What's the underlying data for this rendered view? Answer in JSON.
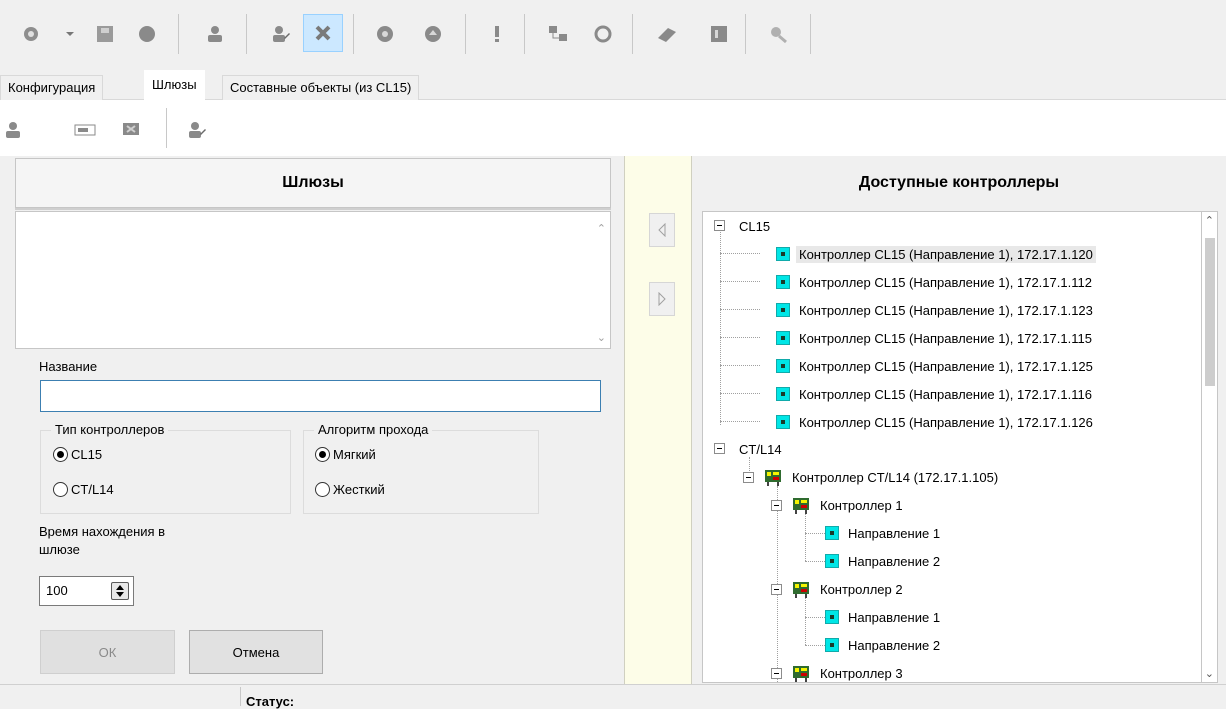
{
  "tabs": [
    {
      "label": "Конфигурация"
    },
    {
      "label": "Шлюзы"
    },
    {
      "label": "Составные объекты (из CL15)"
    }
  ],
  "left": {
    "header": "Шлюзы",
    "name_label": "Название",
    "name_value": "",
    "controller_type": {
      "title": "Тип контроллеров",
      "options": [
        "CL15",
        "CT/L14"
      ],
      "selected": "CL15"
    },
    "algorithm": {
      "title": "Алгоритм прохода",
      "options": [
        "Мягкий",
        "Жесткий"
      ],
      "selected": "Мягкий"
    },
    "time_label_line1": "Время нахождения в",
    "time_label_line2": "шлюзе",
    "time_value": "100",
    "ok_label": "ОК",
    "cancel_label": "Отмена"
  },
  "right": {
    "header": "Доступные контроллеры",
    "tree": {
      "cl15": {
        "label": "CL15",
        "items": [
          "Контроллер CL15 (Направление 1), 172.17.1.120",
          "Контроллер CL15 (Направление 1), 172.17.1.112",
          "Контроллер CL15 (Направление 1), 172.17.1.123",
          "Контроллер CL15 (Направление 1), 172.17.1.115",
          "Контроллер CL15 (Направление 1), 172.17.1.125",
          "Контроллер CL15 (Направление 1), 172.17.1.116",
          "Контроллер CL15 (Направление 1), 172.17.1.126"
        ]
      },
      "ctl14": {
        "label": "CT/L14",
        "controller": "Контроллер CT/L14 (172.17.1.105)",
        "sub1": "Контроллер 1",
        "sub2": "Контроллер 2",
        "sub3": "Контроллер 3",
        "dir1": "Направление 1",
        "dir2": "Направление 2"
      }
    }
  },
  "status": {
    "label": "Статус:"
  }
}
